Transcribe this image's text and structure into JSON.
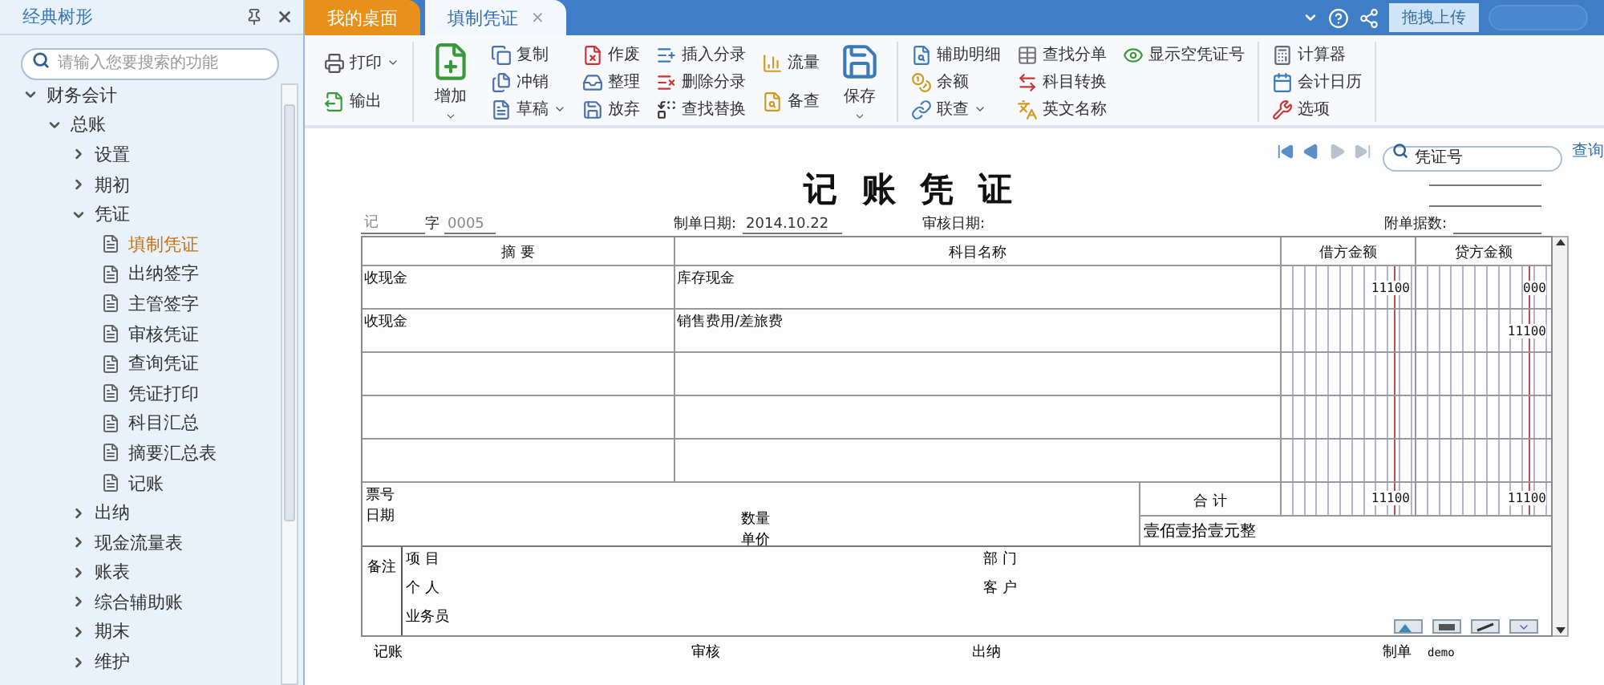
{
  "sidebar": {
    "title": "经典树形",
    "search": {
      "placeholder": "请输入您要搜索的功能"
    },
    "tree": [
      {
        "kind": "group",
        "label": "财务会计",
        "expanded": true,
        "children": [
          {
            "kind": "group",
            "label": "总账",
            "expanded": true,
            "children": [
              {
                "kind": "group",
                "label": "设置",
                "expanded": false
              },
              {
                "kind": "group",
                "label": "期初",
                "expanded": false
              },
              {
                "kind": "group",
                "label": "凭证",
                "expanded": true,
                "children": [
                  {
                    "kind": "page",
                    "label": "填制凭证",
                    "selected": true
                  },
                  {
                    "kind": "page",
                    "label": "出纳签字",
                    "selected": false
                  },
                  {
                    "kind": "page",
                    "label": "主管签字",
                    "selected": false
                  },
                  {
                    "kind": "page",
                    "label": "审核凭证",
                    "selected": false
                  },
                  {
                    "kind": "page",
                    "label": "查询凭证",
                    "selected": false
                  },
                  {
                    "kind": "page",
                    "label": "凭证打印",
                    "selected": false
                  },
                  {
                    "kind": "page",
                    "label": "科目汇总",
                    "selected": false
                  },
                  {
                    "kind": "page",
                    "label": "摘要汇总表",
                    "selected": false
                  },
                  {
                    "kind": "page",
                    "label": "记账",
                    "selected": false
                  }
                ]
              },
              {
                "kind": "group",
                "label": "出纳",
                "expanded": false
              },
              {
                "kind": "group",
                "label": "现金流量表",
                "expanded": false
              },
              {
                "kind": "group",
                "label": "账表",
                "expanded": false
              },
              {
                "kind": "group",
                "label": "综合辅助账",
                "expanded": false
              },
              {
                "kind": "group",
                "label": "期末",
                "expanded": false
              },
              {
                "kind": "group",
                "label": "维护",
                "expanded": false
              }
            ]
          }
        ]
      }
    ]
  },
  "tabs": [
    {
      "label": "我的桌面",
      "selected": false
    },
    {
      "label": "填制凭证",
      "selected": true,
      "close": "×"
    }
  ],
  "upload_button": "拖拽上传",
  "toolbar": {
    "groups": [
      {
        "columns": [
          {
            "kind": "stack",
            "items": [
              {
                "label": "打印",
                "dropdown": true
              },
              {
                "label": "输出",
                "dropdown": false
              }
            ]
          }
        ]
      },
      {
        "columns": [
          {
            "kind": "large",
            "label": "增加",
            "dropdown": true
          },
          {
            "kind": "stack",
            "items": [
              {
                "label": "复制",
                "dropdown": false
              },
              {
                "label": "冲销",
                "dropdown": false
              },
              {
                "label": "草稿",
                "dropdown": true
              }
            ]
          },
          {
            "kind": "stack",
            "items": [
              {
                "label": "作废",
                "dropdown": false
              },
              {
                "label": "整理",
                "dropdown": false
              },
              {
                "label": "放弃",
                "dropdown": false
              }
            ]
          },
          {
            "kind": "stack",
            "items": [
              {
                "label": "插入分录",
                "dropdown": false
              },
              {
                "label": "删除分录",
                "dropdown": false
              },
              {
                "label": "查找替换",
                "dropdown": false
              }
            ]
          },
          {
            "kind": "stack",
            "items": [
              {
                "label": "流量",
                "dropdown": false
              },
              {
                "label": "备查",
                "dropdown": false
              }
            ]
          },
          {
            "kind": "large",
            "label": "保存",
            "dropdown": true
          }
        ]
      },
      {
        "columns": [
          {
            "kind": "stack",
            "items": [
              {
                "label": "辅助明细",
                "dropdown": false
              },
              {
                "label": "余额",
                "dropdown": false
              },
              {
                "label": "联查",
                "dropdown": true
              }
            ]
          },
          {
            "kind": "stack",
            "items": [
              {
                "label": "查找分单",
                "dropdown": false
              },
              {
                "label": "科目转换",
                "dropdown": false
              },
              {
                "label": "英文名称",
                "dropdown": false
              }
            ]
          },
          {
            "kind": "stack",
            "items": [
              {
                "label": "显示空凭证号",
                "dropdown": false
              }
            ]
          }
        ]
      },
      {
        "columns": [
          {
            "kind": "stack",
            "items": [
              {
                "label": "计算器",
                "dropdown": false
              },
              {
                "label": "会计日历",
                "dropdown": false
              },
              {
                "label": "选项",
                "dropdown": false
              }
            ]
          }
        ]
      }
    ]
  },
  "pager": {
    "buttons": [
      {
        "disabled": false
      },
      {
        "disabled": false
      },
      {
        "disabled": true
      },
      {
        "disabled": true
      }
    ],
    "search": {
      "placeholder": "凭证号"
    },
    "query_link": "查询"
  },
  "voucher": {
    "title": "记 账 凭 证",
    "type": "记",
    "type_suffix": "字",
    "number": "0005",
    "date_label": "制单日期:",
    "date": "2014.10.22",
    "audit_date_label": "审核日期:",
    "attachments_label": "附单据数:",
    "columns": [
      "摘 要",
      "科目名称",
      "借方金额",
      "贷方金额"
    ],
    "rows": [
      {
        "summary": "收现金",
        "account": "库存现金",
        "debit": "11100",
        "credit": "000"
      },
      {
        "summary": "收现金",
        "account": "销售费用/差旅费",
        "credit": "11100"
      }
    ],
    "ticket_label": "票号",
    "ticket_date_label": "日期",
    "quantity_label": "数量",
    "price_label": "单价",
    "total_label": "合 计",
    "total_debit": "11100",
    "total_credit": "11100",
    "amount_in_words": "壹佰壹拾壹元整",
    "notes_label": "备注",
    "project_label": "项 目",
    "department_label": "部 门",
    "person_label": "个 人",
    "customer_label": "客 户",
    "salesman_label": "业务员",
    "signatures": [
      {
        "label": "记账"
      },
      {
        "label": "审核"
      },
      {
        "label": "出纳"
      },
      {
        "label": "制单",
        "value": "demo"
      }
    ]
  }
}
